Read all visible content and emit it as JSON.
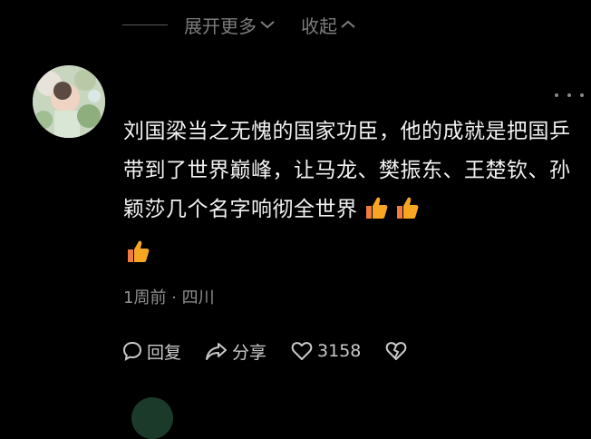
{
  "top_controls": {
    "expand_label": "展开更多",
    "collapse_label": "收起",
    "expand_icon": "chevron-down-icon",
    "collapse_icon": "chevron-up-icon"
  },
  "comment": {
    "avatar": "user-avatar-image",
    "more_icon": "more-dots-icon",
    "text": "刘国梁当之无愧的国家功臣，他的成就是把国乒带到了世界巅峰，让马龙、樊振东、王楚钦、孙颖莎几个名字响彻全世界",
    "emojis": [
      "thumbs-up-icon",
      "thumbs-up-icon",
      "thumbs-up-icon"
    ],
    "meta": "1周前 · 四川"
  },
  "actions": {
    "reply_label": "回复",
    "share_label": "分享",
    "like_count": "3158",
    "reply_icon": "chat-bubble-icon",
    "share_icon": "share-arrow-icon",
    "like_icon": "heart-icon",
    "dislike_icon": "broken-heart-icon"
  },
  "colors": {
    "background": "#000000",
    "text": "#f2f2f2",
    "muted": "#8f8f8f",
    "thumb": "#f6a623"
  }
}
